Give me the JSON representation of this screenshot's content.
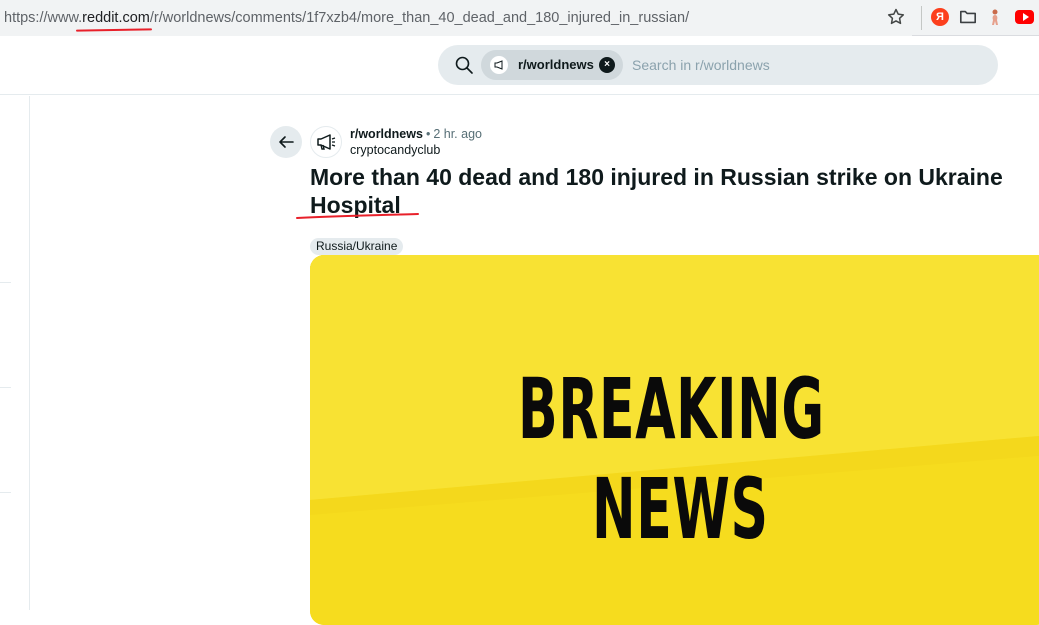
{
  "browser": {
    "url_prefix": "https://www.",
    "url_domain": "reddit.com",
    "url_path": "/r/worldnews/comments/1f7xzb4/more_than_40_dead_and_180_injured_in_russian/",
    "yandex_letter": "Я"
  },
  "search": {
    "chip_label": "r/worldnews",
    "chip_close": "×",
    "placeholder": "Search in r/worldnews"
  },
  "post": {
    "subreddit": "r/worldnews",
    "separator": "•",
    "time": "2 hr. ago",
    "author": "cryptocandyclub",
    "title": "More than 40 dead and 180 injured in Russian strike on Ukraine Hospital",
    "flair": "Russia/Ukraine"
  },
  "media": {
    "line1": "BREAKING",
    "line2": "NEWS",
    "bg_color": "#f6dc1e"
  },
  "colors": {
    "annotation_red": "#e8202a",
    "text_primary": "#0f1a1c",
    "text_secondary": "#576f76"
  }
}
